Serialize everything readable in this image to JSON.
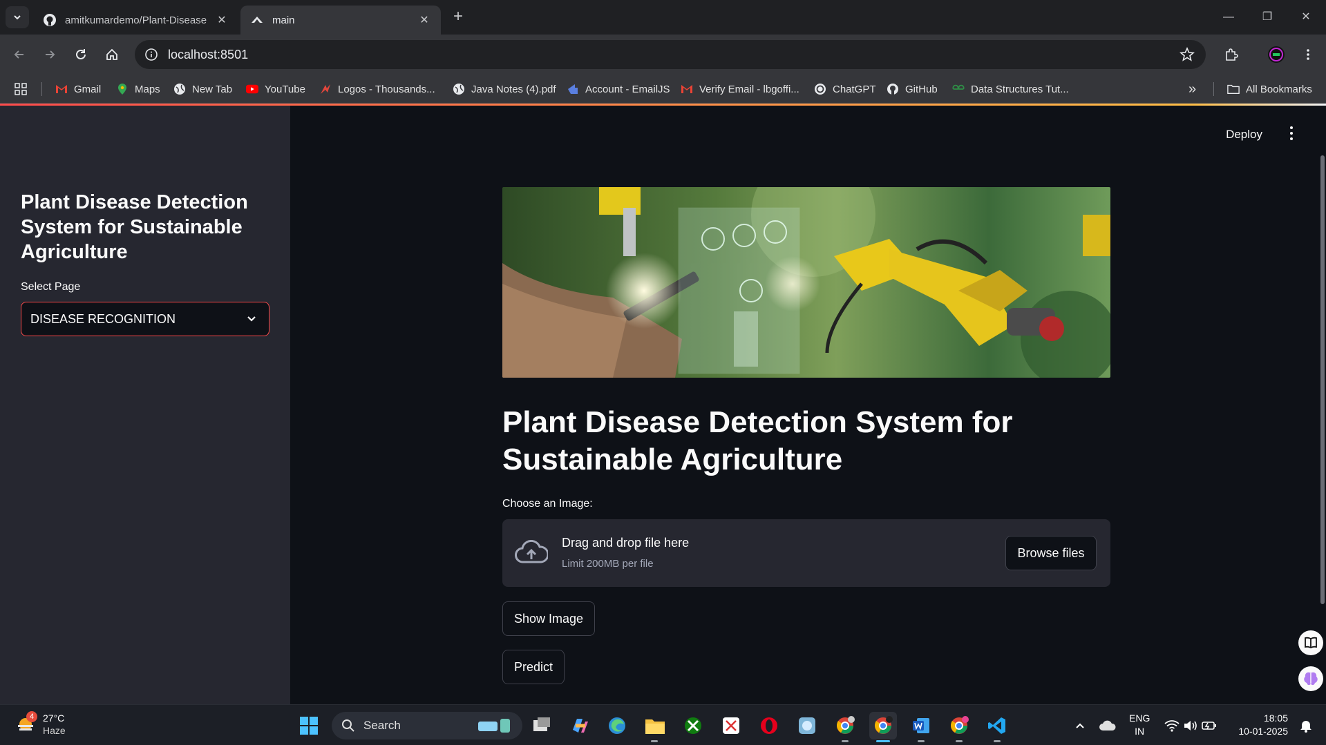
{
  "browser": {
    "tabs": [
      {
        "title": "amitkumardemo/Plant-Disease",
        "close": "✕"
      },
      {
        "title": "main",
        "close": "✕"
      }
    ],
    "new_tab": "+",
    "window_controls": {
      "minimize": "—",
      "restore": "❐",
      "close": "✕"
    },
    "address": "localhost:8501",
    "bookmarks": [
      {
        "label": "Gmail",
        "icon": "gmail-icon"
      },
      {
        "label": "Maps",
        "icon": "maps-icon"
      },
      {
        "label": "New Tab",
        "icon": "globe-icon"
      },
      {
        "label": "YouTube",
        "icon": "youtube-icon"
      },
      {
        "label": "Logos - Thousands...",
        "icon": "logos-icon"
      },
      {
        "label": "Java Notes (4).pdf",
        "icon": "globe-icon"
      },
      {
        "label": "Account - EmailJS",
        "icon": "emailjs-icon"
      },
      {
        "label": "Verify Email - lbgoffi...",
        "icon": "gmail-icon"
      },
      {
        "label": "ChatGPT",
        "icon": "chatgpt-icon"
      },
      {
        "label": "GitHub",
        "icon": "github-icon"
      },
      {
        "label": "Data Structures Tut...",
        "icon": "gfg-icon"
      }
    ],
    "overflow": "»",
    "all_bookmarks": "All Bookmarks"
  },
  "sidebar": {
    "title": "Plant Disease Detection System for Sustainable Agriculture",
    "select_label": "Select Page",
    "select_value": "DISEASE RECOGNITION"
  },
  "header": {
    "deploy": "Deploy"
  },
  "main": {
    "title": "Plant Disease Detection System for Sustainable Agriculture",
    "uploader_label": "Choose an Image:",
    "drop_text": "Drag and drop file here",
    "limit_text": "Limit 200MB per file",
    "browse_label": "Browse files",
    "show_image_label": "Show Image",
    "predict_label": "Predict"
  },
  "taskbar": {
    "weather_badge": "4",
    "temperature": "27°C",
    "condition": "Haze",
    "search_placeholder": "Search",
    "lang_top": "ENG",
    "lang_bottom": "IN",
    "time": "18:05",
    "date": "10-01-2025"
  },
  "colors": {
    "accent": "#ff4b4b",
    "sidebar_bg": "#262730",
    "main_bg": "#0e1117"
  }
}
